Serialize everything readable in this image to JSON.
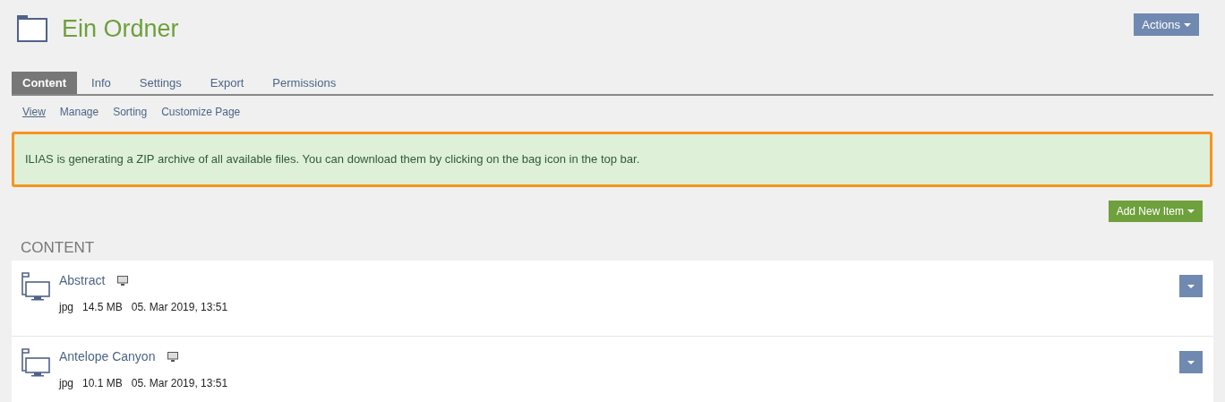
{
  "header": {
    "title": "Ein Ordner",
    "actions_button": "Actions"
  },
  "tabs": [
    {
      "label": "Content",
      "selected": true
    },
    {
      "label": "Info",
      "selected": false
    },
    {
      "label": "Settings",
      "selected": false
    },
    {
      "label": "Export",
      "selected": false
    },
    {
      "label": "Permissions",
      "selected": false
    }
  ],
  "subtabs": [
    {
      "label": "View",
      "selected": true
    },
    {
      "label": "Manage",
      "selected": false
    },
    {
      "label": "Sorting",
      "selected": false
    },
    {
      "label": "Customize Page",
      "selected": false
    }
  ],
  "message": "ILIAS is generating a ZIP archive of all available files. You can download them by clicking on the bag icon in the top bar.",
  "add_button": "Add New Item",
  "section_title": "CONTENT",
  "items": [
    {
      "title": "Abstract",
      "type": "jpg",
      "size": "14.5 MB",
      "date": "05. Mar 2019, 13:51"
    },
    {
      "title": "Antelope Canyon",
      "type": "jpg",
      "size": "10.1 MB",
      "date": "05. Mar 2019, 13:51"
    }
  ]
}
